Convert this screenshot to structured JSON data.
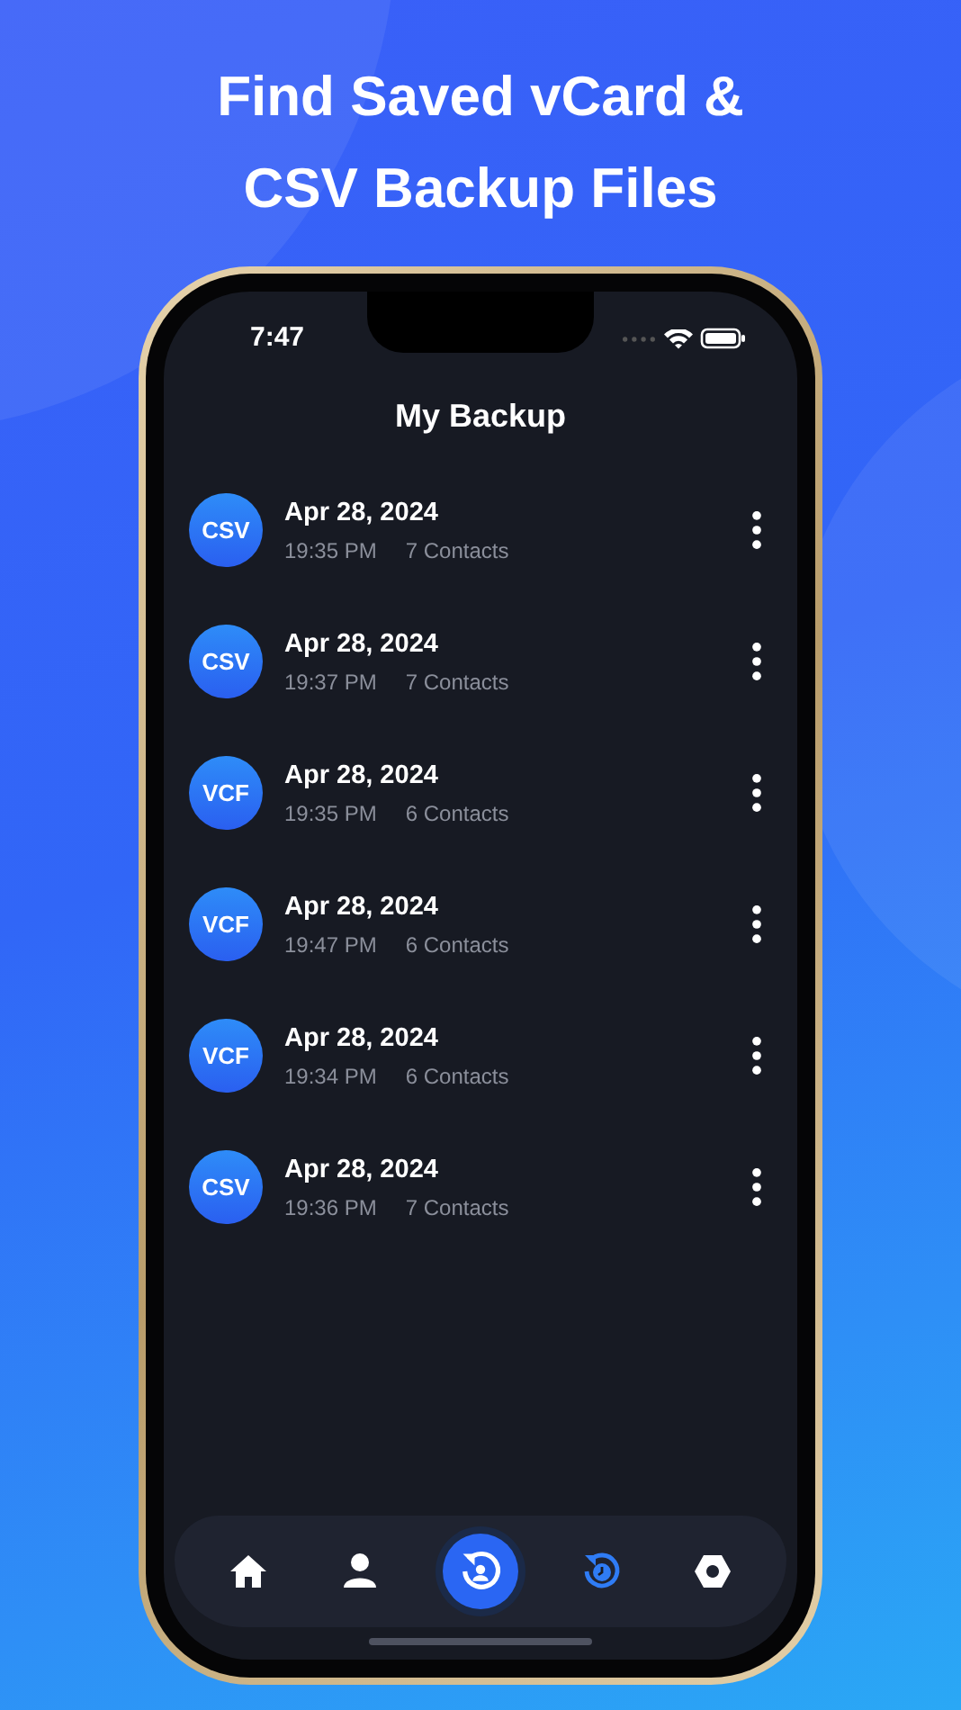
{
  "headline": [
    "Find Saved vCard &",
    "CSV Backup Files"
  ],
  "status_bar": {
    "time": "7:47"
  },
  "screen_title": "My Backup",
  "backups": [
    {
      "format": "CSV",
      "date": "Apr 28, 2024",
      "time": "19:35 PM",
      "count": "7 Contacts"
    },
    {
      "format": "CSV",
      "date": "Apr 28, 2024",
      "time": "19:37 PM",
      "count": "7 Contacts"
    },
    {
      "format": "VCF",
      "date": "Apr 28, 2024",
      "time": "19:35 PM",
      "count": "6 Contacts"
    },
    {
      "format": "VCF",
      "date": "Apr 28, 2024",
      "time": "19:47 PM",
      "count": "6 Contacts"
    },
    {
      "format": "VCF",
      "date": "Apr 28, 2024",
      "time": "19:34 PM",
      "count": "6 Contacts"
    },
    {
      "format": "CSV",
      "date": "Apr 28, 2024",
      "time": "19:36 PM",
      "count": "7 Contacts"
    }
  ],
  "tab_bar": [
    {
      "kind": "tab",
      "selected": false
    },
    {
      "kind": "tab",
      "selected": false
    },
    {
      "kind": "action"
    },
    {
      "kind": "tab",
      "selected": true
    },
    {
      "kind": "tab",
      "selected": false
    }
  ]
}
